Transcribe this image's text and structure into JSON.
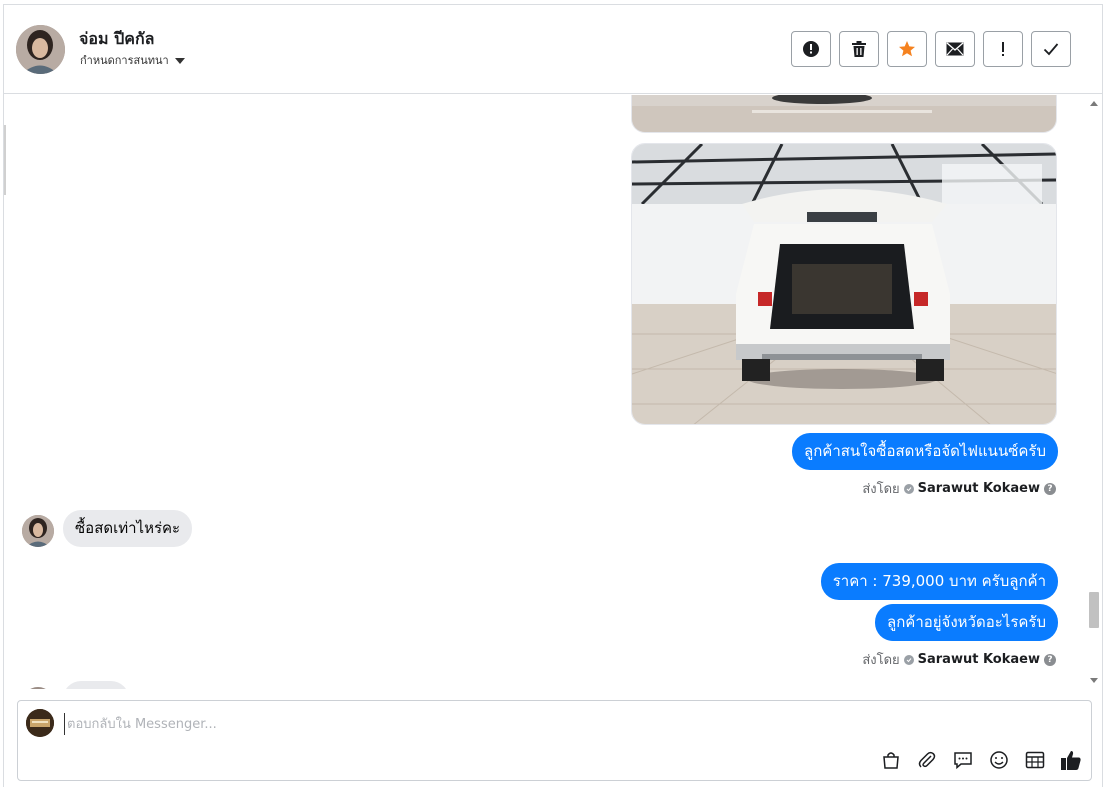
{
  "header": {
    "name": "จ่อม ปีคกัล",
    "subtitle": "กำหนดการสนทนา"
  },
  "actions": [
    {
      "name": "report-spam-button",
      "icon": "exclamation-circle-icon"
    },
    {
      "name": "delete-button",
      "icon": "trash-icon"
    },
    {
      "name": "star-button",
      "icon": "star-icon"
    },
    {
      "name": "mark-unread-button",
      "icon": "envelope-icon"
    },
    {
      "name": "follow-up-button",
      "icon": "exclamation-icon"
    },
    {
      "name": "done-button",
      "icon": "check-icon"
    }
  ],
  "messages": {
    "out_1": "ลูกค้าสนใจซื้อสดหรือจัดไฟแนนซ์ครับ",
    "sent_by_label": "ส่งโดย",
    "agent_name": "Sarawut Kokaew",
    "in_1": "ซื้อสดเท่าไหร่คะ",
    "out_2": "ราคา : 739,000 บาท ครับลูกค้า",
    "out_3": "ลูกค้าอยู่จังหวัดอะไรครับ"
  },
  "composer": {
    "placeholder": "ตอบกลับใน Messenger..."
  },
  "colors": {
    "accent": "#0a7cff",
    "star": "#f5821f"
  }
}
